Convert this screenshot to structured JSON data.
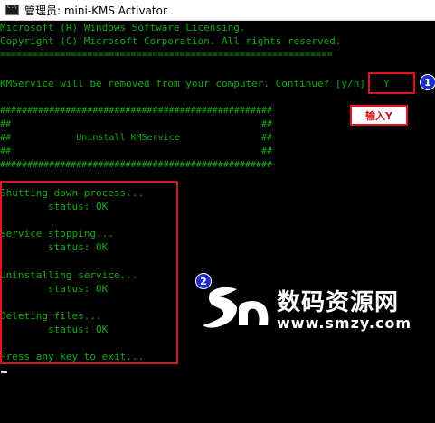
{
  "window": {
    "title": "管理员: mini-KMS Activator"
  },
  "console": {
    "lines": [
      "Microsoft (R) Windows Software Licensing.",
      "Copyright (C) Microsoft Corporation. All rights reserved.",
      "=============================================================",
      "",
      "KMService will be removed from your computer. Continue? [y/n]",
      "",
      "##################################################",
      "##                                              ##",
      "##            Uninstall KMService               ##",
      "##                                              ##",
      "##################################################",
      "",
      "Shutting down process...",
      "        status: OK",
      "",
      "Service stopping...",
      "        status: OK",
      "",
      "Uninstalling service...",
      "        status: OK",
      "",
      "Deleting files...",
      "        status: OK",
      "",
      "Press any key to exit..."
    ],
    "answer": "Y"
  },
  "annotations": {
    "badge1": "1",
    "badge2": "2",
    "input_label": "输入Y"
  },
  "watermark": {
    "text": "数码资源网",
    "url": "www.smzy.com"
  },
  "colors": {
    "console_text": "#10a810",
    "highlight_border": "#e0141c",
    "badge_fill": "#1e2fc8"
  }
}
